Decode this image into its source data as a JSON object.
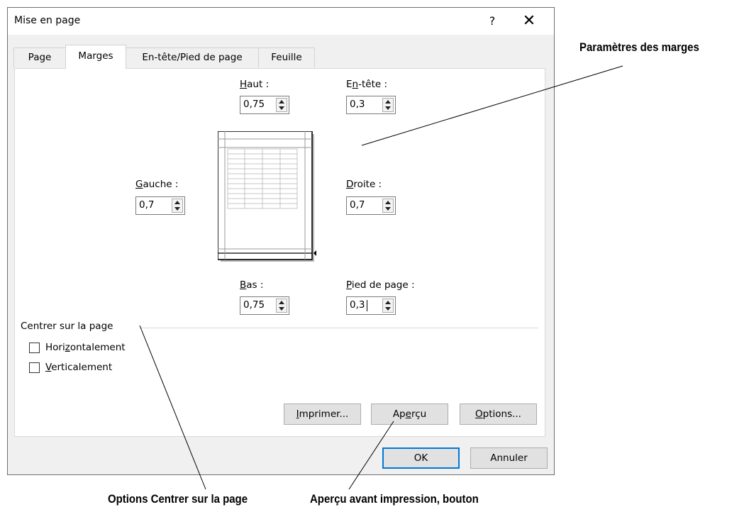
{
  "dialog": {
    "title": "Mise en page",
    "help": "?",
    "close": "✕"
  },
  "tabs": [
    {
      "label": "Page",
      "active": false
    },
    {
      "label": "Marges",
      "active": true
    },
    {
      "label": "En-tête/Pied de page",
      "active": false
    },
    {
      "label": "Feuille",
      "active": false
    }
  ],
  "margins": {
    "haut": {
      "label_pre": "",
      "label_u": "H",
      "label_post": "aut :",
      "value": "0,75"
    },
    "entete": {
      "label_pre": "E",
      "label_u": "n",
      "label_post": "-tête :",
      "value": "0,3"
    },
    "gauche": {
      "label_pre": "",
      "label_u": "G",
      "label_post": "auche :",
      "value": "0,7"
    },
    "droite": {
      "label_pre": "",
      "label_u": "D",
      "label_post": "roite :",
      "value": "0,7"
    },
    "bas": {
      "label_pre": "",
      "label_u": "B",
      "label_post": "as :",
      "value": "0,75"
    },
    "pied": {
      "label_pre": "",
      "label_u": "P",
      "label_post": "ied de page :",
      "value": "0,3"
    }
  },
  "center": {
    "group_label": "Centrer sur la page",
    "horizontal": {
      "pre": "Hori",
      "u": "z",
      "post": "ontalement",
      "checked": false
    },
    "vertical": {
      "pre": "",
      "u": "V",
      "post": "erticalement",
      "checked": false
    }
  },
  "buttons": {
    "print": {
      "pre": "",
      "u": "I",
      "post": "mprimer..."
    },
    "preview": {
      "pre": "Ap",
      "u": "e",
      "post": "rçu"
    },
    "options": {
      "pre": "",
      "u": "O",
      "post": "ptions..."
    },
    "ok": "OK",
    "cancel": "Annuler"
  },
  "captions": {
    "margins": "Paramètres des marges",
    "center": "Options Centrer sur la page",
    "preview": "Aperçu avant impression, bouton"
  },
  "colors": {
    "accent": "#0078d7",
    "dialog_bg": "#f0f0f0"
  }
}
